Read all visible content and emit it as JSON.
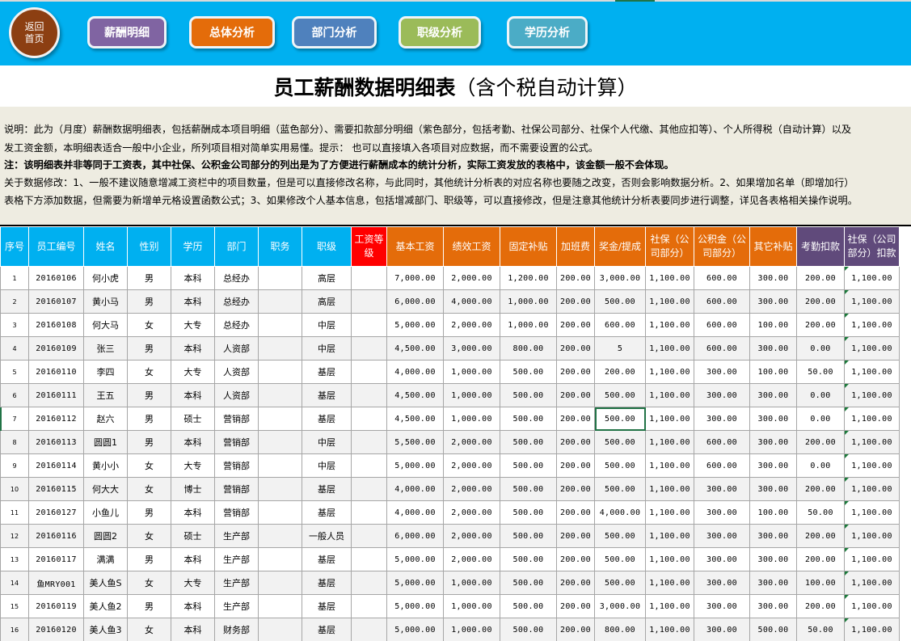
{
  "nav": {
    "home": "返回首页",
    "buttons": [
      {
        "label": "薪酬明细",
        "color": "#8064a2"
      },
      {
        "label": "总体分析",
        "color": "#e46c0a"
      },
      {
        "label": "部门分析",
        "color": "#4f81bd"
      },
      {
        "label": "职级分析",
        "color": "#9bbb59"
      },
      {
        "label": "学历分析",
        "color": "#4bacc6"
      }
    ]
  },
  "title": {
    "main": "员工薪酬数据明细表",
    "sub": "（含个税自动计算）"
  },
  "description": {
    "line1": "说明：此为（月度）薪酬数据明细表，包括薪酬成本项目明细（蓝色部分）、需要扣款部分明细（紫色部分，包括考勤、社保公司部分、社保个人代缴、其他应扣等）、个人所得税（自动计算）以及",
    "line2": "发工资金额，本明细表适合一般中小企业，所列项目相对简单实用易懂。提示： 也可以直接填入各项目对应数据，而不需要设置的公式。",
    "line3": "注：该明细表并非等同于工资表，其中社保、公积金公司部分的列出是为了方便进行薪酬成本的统计分析，实际工资发放的表格中，该金额一般不会体现。",
    "line4": "关于数据修改：1、一般不建议随意增减工资栏中的项目数量，但是可以直接修改名称，与此同时，其他统计分析表的对应名称也要随之改变，否则会影响数据分析。2、如果增加名单（即增加行）",
    "line5": "表格下方添加数据，但需要为新增单元格设置函数公式；3、如果修改个人基本信息，包括增减部门、职级等，可以直接修改，但是注意其他统计分析表要同步进行调整，详见各表格相关操作说明。"
  },
  "colors": {
    "blue_header": "#00b0f0",
    "red_header": "#ff0000",
    "orange_header": "#e46c0a",
    "purple_header": "#604a7b"
  },
  "table": {
    "headers": [
      "序号",
      "员工编号",
      "姓名",
      "性别",
      "学历",
      "部门",
      "职务",
      "职级",
      "工资等级",
      "基本工资",
      "绩效工资",
      "固定补贴",
      "加班费",
      "奖金/提成",
      "社保（公司部分）",
      "公积金（公司部分）",
      "其它补贴",
      "考勤扣款",
      "社保（公司部分）扣款"
    ],
    "rows": [
      [
        "1",
        "20160106",
        "何小虎",
        "男",
        "本科",
        "总经办",
        "",
        "高层",
        "",
        "7,000.00",
        "2,000.00",
        "1,200.00",
        "200.00",
        "3,000.00",
        "1,100.00",
        "600.00",
        "300.00",
        "200.00",
        "1,100.00"
      ],
      [
        "2",
        "20160107",
        "黄小马",
        "男",
        "本科",
        "总经办",
        "",
        "高层",
        "",
        "6,000.00",
        "4,000.00",
        "1,000.00",
        "200.00",
        "500.00",
        "1,100.00",
        "600.00",
        "300.00",
        "200.00",
        "1,100.00"
      ],
      [
        "3",
        "20160108",
        "何大马",
        "女",
        "大专",
        "总经办",
        "",
        "中层",
        "",
        "5,000.00",
        "2,000.00",
        "1,000.00",
        "200.00",
        "600.00",
        "1,100.00",
        "600.00",
        "100.00",
        "200.00",
        "1,100.00"
      ],
      [
        "4",
        "20160109",
        "张三",
        "男",
        "本科",
        "人资部",
        "",
        "中层",
        "",
        "4,500.00",
        "3,000.00",
        "800.00",
        "200.00",
        "5",
        "1,100.00",
        "600.00",
        "300.00",
        "0.00",
        "1,100.00"
      ],
      [
        "5",
        "20160110",
        "李四",
        "女",
        "大专",
        "人资部",
        "",
        "基层",
        "",
        "4,000.00",
        "1,000.00",
        "500.00",
        "200.00",
        "200.00",
        "1,100.00",
        "300.00",
        "100.00",
        "50.00",
        "1,100.00"
      ],
      [
        "6",
        "20160111",
        "王五",
        "男",
        "本科",
        "人资部",
        "",
        "基层",
        "",
        "4,500.00",
        "1,000.00",
        "500.00",
        "200.00",
        "500.00",
        "1,100.00",
        "300.00",
        "300.00",
        "0.00",
        "1,100.00"
      ],
      [
        "7",
        "20160112",
        "赵六",
        "男",
        "硕士",
        "营销部",
        "",
        "基层",
        "",
        "4,500.00",
        "1,000.00",
        "500.00",
        "200.00",
        "500.00",
        "1,100.00",
        "300.00",
        "300.00",
        "0.00",
        "1,100.00"
      ],
      [
        "8",
        "20160113",
        "圆圆1",
        "男",
        "本科",
        "营销部",
        "",
        "中层",
        "",
        "5,500.00",
        "2,000.00",
        "500.00",
        "200.00",
        "500.00",
        "1,100.00",
        "600.00",
        "300.00",
        "200.00",
        "1,100.00"
      ],
      [
        "9",
        "20160114",
        "黄小小",
        "女",
        "大专",
        "营销部",
        "",
        "中层",
        "",
        "5,000.00",
        "2,000.00",
        "500.00",
        "200.00",
        "500.00",
        "1,100.00",
        "600.00",
        "300.00",
        "0.00",
        "1,100.00"
      ],
      [
        "10",
        "20160115",
        "何大大",
        "女",
        "博士",
        "营销部",
        "",
        "基层",
        "",
        "4,000.00",
        "2,000.00",
        "500.00",
        "200.00",
        "500.00",
        "1,100.00",
        "300.00",
        "300.00",
        "200.00",
        "1,100.00"
      ],
      [
        "11",
        "20160127",
        "小鱼儿",
        "男",
        "本科",
        "营销部",
        "",
        "基层",
        "",
        "4,000.00",
        "2,000.00",
        "500.00",
        "200.00",
        "4,000.00",
        "1,100.00",
        "300.00",
        "100.00",
        "50.00",
        "1,100.00"
      ],
      [
        "12",
        "20160116",
        "圆圆2",
        "女",
        "硕士",
        "生产部",
        "",
        "一般人员",
        "",
        "6,000.00",
        "2,000.00",
        "500.00",
        "200.00",
        "500.00",
        "1,100.00",
        "300.00",
        "300.00",
        "200.00",
        "1,100.00"
      ],
      [
        "13",
        "20160117",
        "满满",
        "男",
        "本科",
        "生产部",
        "",
        "基层",
        "",
        "5,000.00",
        "2,000.00",
        "500.00",
        "200.00",
        "500.00",
        "1,100.00",
        "300.00",
        "300.00",
        "200.00",
        "1,100.00"
      ],
      [
        "14",
        "鱼MRY001",
        "美人鱼S",
        "女",
        "大专",
        "生产部",
        "",
        "基层",
        "",
        "5,000.00",
        "1,000.00",
        "500.00",
        "200.00",
        "500.00",
        "1,100.00",
        "300.00",
        "300.00",
        "100.00",
        "1,100.00"
      ],
      [
        "15",
        "20160119",
        "美人鱼2",
        "男",
        "本科",
        "生产部",
        "",
        "基层",
        "",
        "5,000.00",
        "1,000.00",
        "500.00",
        "200.00",
        "3,000.00",
        "1,100.00",
        "300.00",
        "300.00",
        "200.00",
        "1,100.00"
      ],
      [
        "16",
        "20160120",
        "美人鱼3",
        "女",
        "本科",
        "财务部",
        "",
        "基层",
        "",
        "5,000.00",
        "1,000.00",
        "500.00",
        "200.00",
        "800.00",
        "1,100.00",
        "300.00",
        "500.00",
        "50.00",
        "1,100.00"
      ]
    ]
  }
}
